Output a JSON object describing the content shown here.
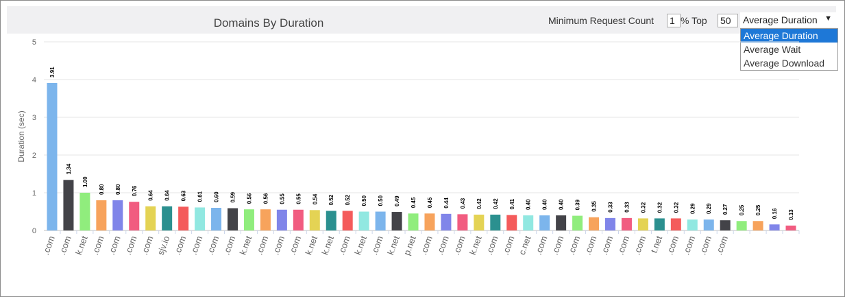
{
  "controls": {
    "min_request_label": "Minimum Request Count",
    "min_request_value": "1",
    "top_label": "% Top",
    "top_value": "50",
    "metric_selected": "Average Duration",
    "metric_options": [
      "Average Duration",
      "Average Wait",
      "Average Download"
    ],
    "dropdown_arrow": "▼"
  },
  "chart_data": {
    "type": "bar",
    "title": "Domains By Duration",
    "ylabel": "Duration (sec)",
    "ylim": [
      0,
      5
    ],
    "yticks": [
      0,
      1,
      2,
      3,
      4,
      5
    ],
    "grid": true,
    "categories": [
      ".com",
      ".com",
      "k.net",
      ".com",
      ".com",
      ".com",
      ".com",
      "sjv.io",
      ".com",
      ".com",
      ".com",
      ".com",
      "k.net",
      ".com",
      ".com",
      ".com",
      "k.net",
      "k.net",
      ".com",
      "k.net",
      ".com",
      "k.net",
      "p.net",
      ".com",
      ".com",
      ".com",
      "k.net",
      ".com",
      ".com",
      "c.net",
      ".com",
      ".com",
      ".com",
      ".com",
      ".com",
      ".com",
      ".com",
      "t.net",
      ".com",
      ".com",
      ".com",
      ".com"
    ],
    "values": [
      3.91,
      1.34,
      1.0,
      0.8,
      0.8,
      0.76,
      0.64,
      0.64,
      0.63,
      0.61,
      0.6,
      0.59,
      0.56,
      0.56,
      0.55,
      0.55,
      0.54,
      0.52,
      0.52,
      0.5,
      0.5,
      0.49,
      0.45,
      0.45,
      0.44,
      0.43,
      0.42,
      0.42,
      0.41,
      0.4,
      0.4,
      0.4,
      0.39,
      0.35,
      0.33,
      0.33,
      0.32,
      0.32,
      0.32,
      0.29,
      0.29,
      0.27,
      0.25,
      0.25,
      0.16,
      0.13
    ],
    "value_labels": [
      "3.91",
      "1.34",
      "1.00",
      "0.80",
      "0.80",
      "0.76",
      "0.64",
      "0.64",
      "0.63",
      "0.61",
      "0.60",
      "0.59",
      "0.56",
      "0.56",
      "0.55",
      "0.55",
      "0.54",
      "0.52",
      "0.52",
      "0.50",
      "0.50",
      "0.49",
      "0.45",
      "0.45",
      "0.44",
      "0.43",
      "0.42",
      "0.42",
      "0.41",
      "0.40",
      "0.40",
      "0.40",
      "0.39",
      "0.35",
      "0.33",
      "0.33",
      "0.32",
      "0.32",
      "0.32",
      "0.29",
      "0.29",
      "0.27",
      "0.25",
      "0.25",
      "0.16",
      "0.13"
    ],
    "colors": [
      "#7cb5ec",
      "#434348",
      "#90ed7d",
      "#f7a35c",
      "#8085e9",
      "#f15c80",
      "#e4d354",
      "#2b908f",
      "#f45b5b",
      "#91e8e1"
    ]
  }
}
